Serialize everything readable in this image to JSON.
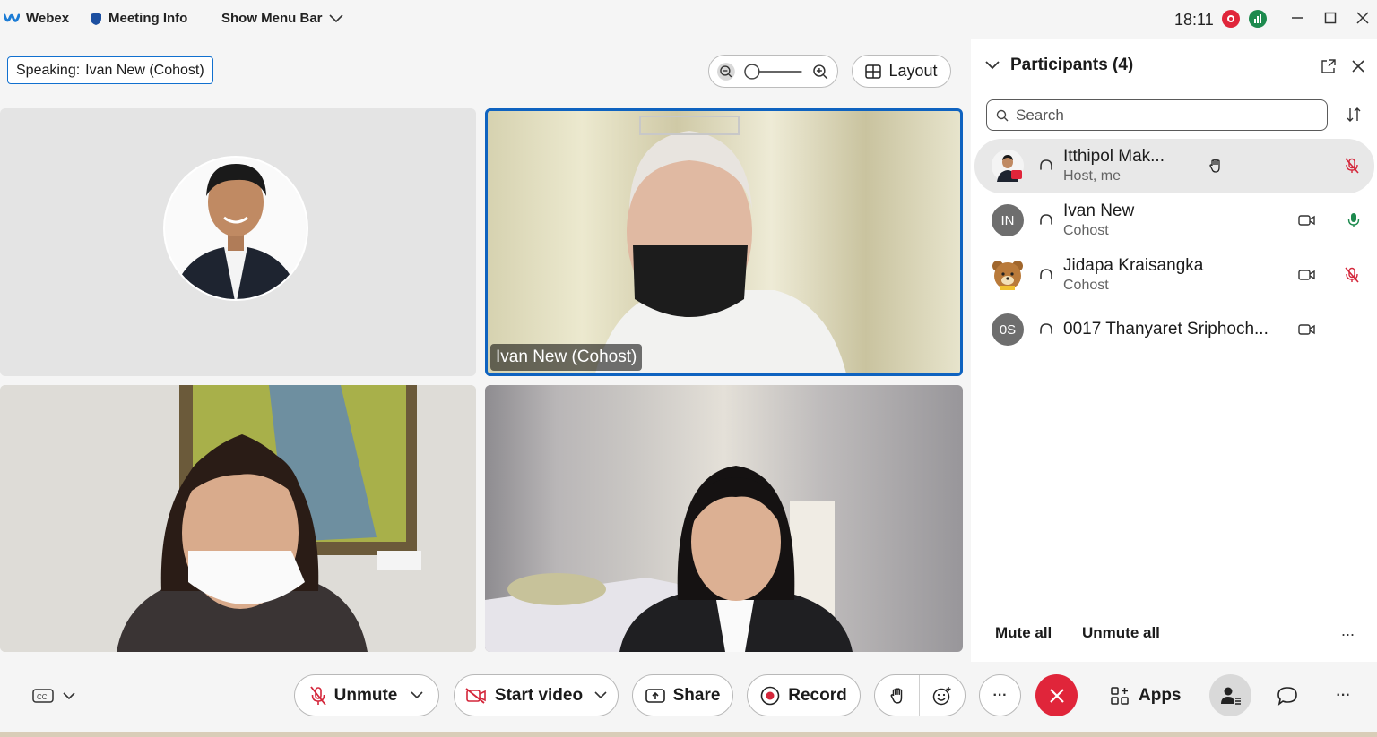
{
  "titlebar": {
    "app_name": "Webex",
    "meeting_info": "Meeting Info",
    "show_menu_bar": "Show Menu Bar",
    "time": "18:11"
  },
  "speaking": {
    "prefix": "Speaking:",
    "name": "Ivan New (Cohost)"
  },
  "view": {
    "layout_label": "Layout"
  },
  "videos": [
    {
      "label": ""
    },
    {
      "label": "Ivan New (Cohost)"
    },
    {
      "label": ""
    },
    {
      "label": ""
    }
  ],
  "participants": {
    "title": "Participants (4)",
    "search_placeholder": "Search",
    "list": [
      {
        "name": "Itthipol Mak...",
        "role": "Host, me",
        "initials": "",
        "mic": "muted",
        "extra": "hand"
      },
      {
        "name": "Ivan New",
        "role": "Cohost",
        "initials": "IN",
        "mic": "active",
        "extra": "video"
      },
      {
        "name": "Jidapa Kraisangka",
        "role": "Cohost",
        "initials": "",
        "mic": "muted",
        "extra": "video"
      },
      {
        "name": "0017 Thanyaret Sriphoch...",
        "role": "",
        "initials": "0S",
        "mic": "none",
        "extra": "video"
      }
    ],
    "mute_all": "Mute all",
    "unmute_all": "Unmute all",
    "more": "..."
  },
  "toolbar": {
    "unmute": "Unmute",
    "start_video": "Start video",
    "share": "Share",
    "record": "Record",
    "more": "···",
    "apps": "Apps",
    "overflow": "···"
  },
  "colors": {
    "accent_blue": "#1170cf",
    "end_red": "#e0253a",
    "mute_red": "#d4263a",
    "mic_green": "#1d8a4e"
  }
}
